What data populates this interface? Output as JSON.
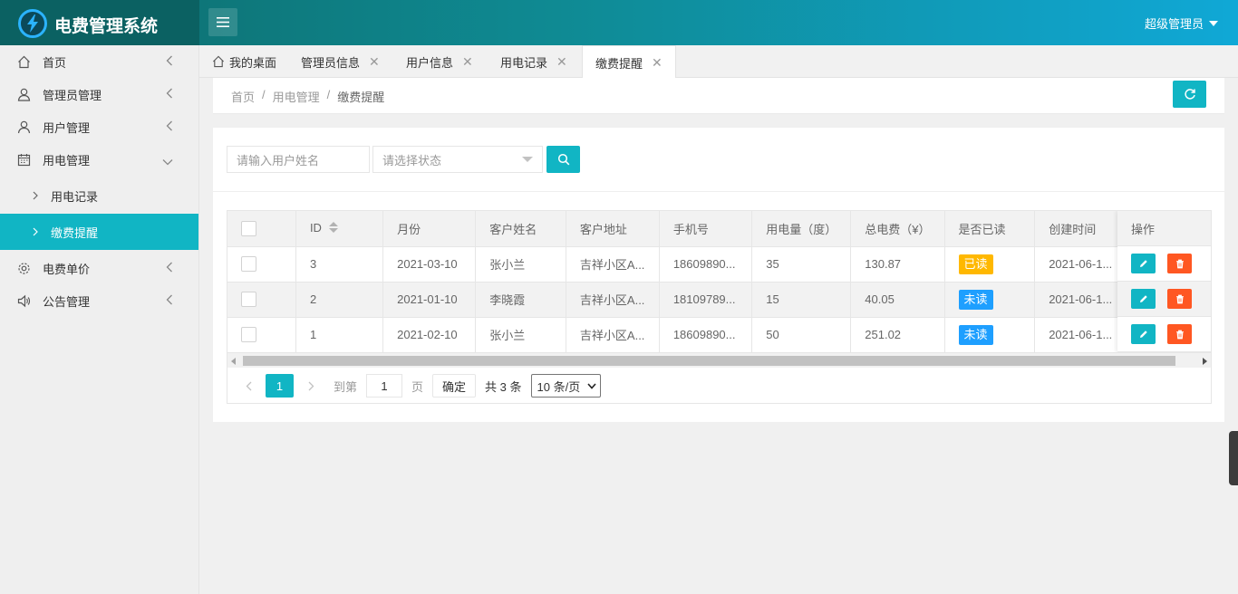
{
  "app": {
    "title": "电费管理系统",
    "user": "超级管理员"
  },
  "colors": {
    "accent": "#11b5c4",
    "danger": "#ff5722",
    "warning": "#ffb800",
    "info": "#1e9fff"
  },
  "sidebar": {
    "items": [
      {
        "label": "首页",
        "icon": "home-icon"
      },
      {
        "label": "管理员管理",
        "icon": "admin-icon"
      },
      {
        "label": "用户管理",
        "icon": "user-icon"
      },
      {
        "label": "用电管理",
        "icon": "calendar-icon"
      },
      {
        "label": "电费单价",
        "icon": "gear-icon"
      },
      {
        "label": "公告管理",
        "icon": "speaker-icon"
      }
    ],
    "sub_items": [
      {
        "label": "用电记录"
      },
      {
        "label": "缴费提醒"
      }
    ]
  },
  "tabs": [
    {
      "label": "我的桌面"
    },
    {
      "label": "管理员信息"
    },
    {
      "label": "用户信息"
    },
    {
      "label": "用电记录"
    },
    {
      "label": "缴费提醒"
    }
  ],
  "breadcrumb": {
    "home": "首页",
    "sep": "/",
    "parent": "用电管理",
    "current": "缴费提醒"
  },
  "search": {
    "name_placeholder": "请输入用户姓名",
    "status_placeholder": "请选择状态"
  },
  "table": {
    "headers": [
      "ID",
      "月份",
      "客户姓名",
      "客户地址",
      "手机号",
      "用电量（度）",
      "总电费（¥）",
      "是否已读",
      "创建时间",
      "操作"
    ],
    "rows": [
      {
        "id": "3",
        "month": "2021-03-10",
        "name": "张小兰",
        "address": "吉祥小区A...",
        "phone": "18609890...",
        "usage": "35",
        "total": "130.87",
        "read": "已读",
        "created": "2021-06-1..."
      },
      {
        "id": "2",
        "month": "2021-01-10",
        "name": "李晓霞",
        "address": "吉祥小区A...",
        "phone": "18109789...",
        "usage": "15",
        "total": "40.05",
        "read": "未读",
        "created": "2021-06-1..."
      },
      {
        "id": "1",
        "month": "2021-02-10",
        "name": "张小兰",
        "address": "吉祥小区A...",
        "phone": "18609890...",
        "usage": "50",
        "total": "251.02",
        "read": "未读",
        "created": "2021-06-1..."
      }
    ]
  },
  "pager": {
    "current": "1",
    "goto_label": "到第",
    "page_input": "1",
    "page_unit": "页",
    "confirm": "确定",
    "total": "共 3 条",
    "page_size": "10 条/页"
  }
}
